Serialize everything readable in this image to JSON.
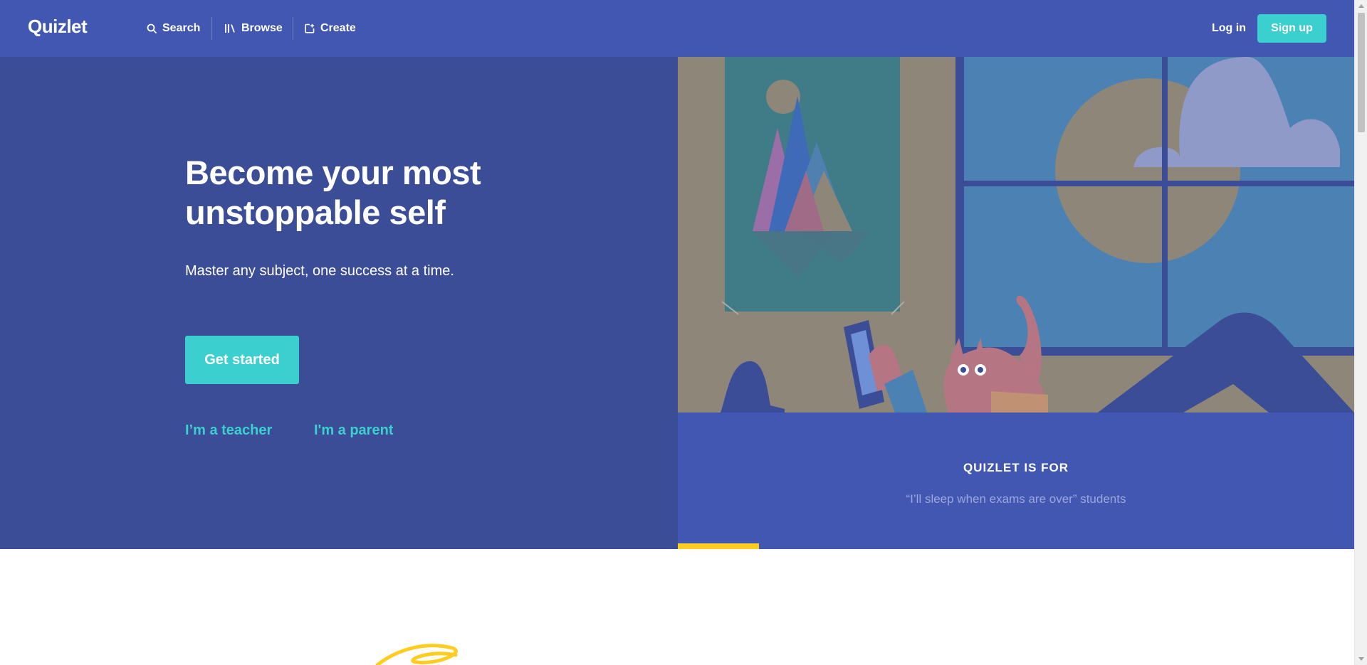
{
  "nav": {
    "logo": "Quizlet",
    "search": "Search",
    "browse": "Browse",
    "create": "Create",
    "login": "Log in",
    "signup": "Sign up"
  },
  "hero": {
    "title": "Become your most unstoppable self",
    "subtitle": "Master any subject, one success at a time.",
    "cta": "Get started",
    "teacher_link": "I’m a teacher",
    "parent_link": "I'm a parent"
  },
  "quizlet_for": {
    "heading": "QUIZLET IS FOR",
    "phrase": "“I’ll sleep when exams are over” students",
    "progress_fraction": 0.12
  },
  "colors": {
    "nav_bg": "#4257b2",
    "hero_bg": "#3c4d97",
    "accent_teal": "#3ccfcf",
    "accent_yellow": "#ffcd1f"
  },
  "icons": {
    "search": "search-icon",
    "browse": "library-icon",
    "create": "create-icon"
  }
}
